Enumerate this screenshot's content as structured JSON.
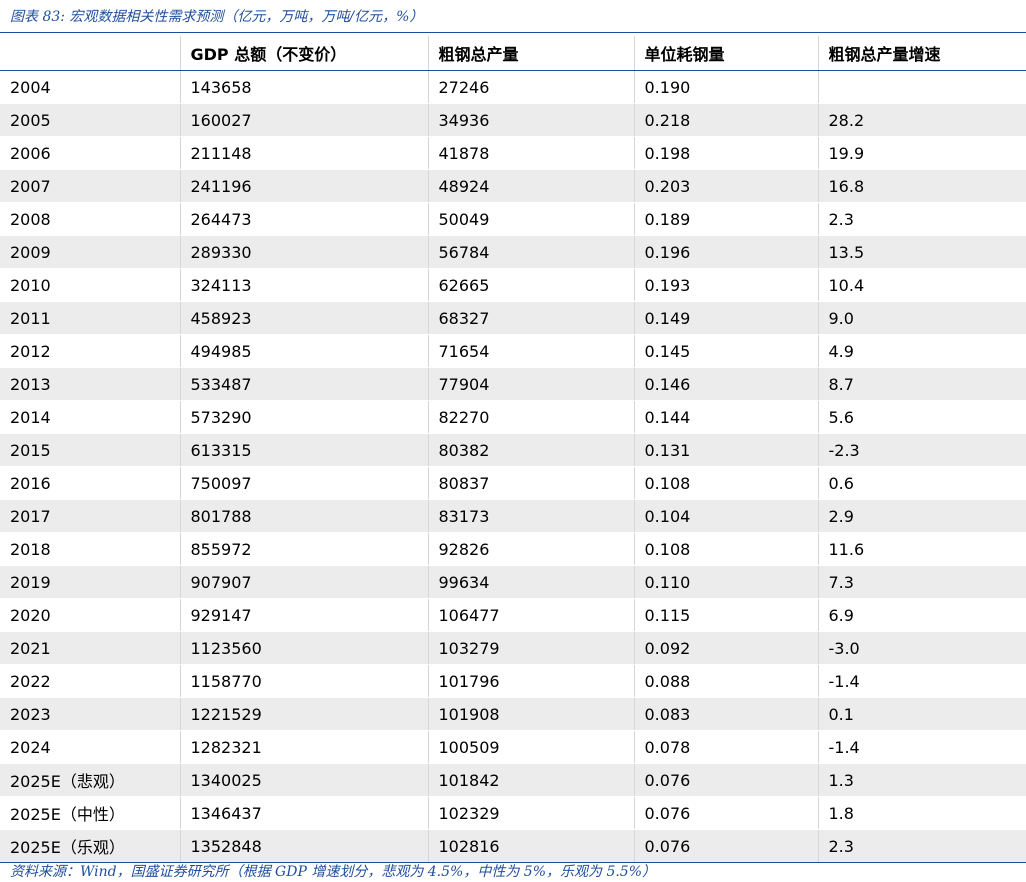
{
  "caption": "图表 83:  宏观数据相关性需求预测（亿元，万吨，万吨/亿元，%）",
  "source": "资料来源：Wind，国盛证券研究所（根据 GDP 增速划分，悲观为 4.5%，中性为 5%，乐观为 5.5%）",
  "colors": {
    "accent": "#1f4e9b",
    "row_shade": "#ececec"
  },
  "table": {
    "headers": [
      "",
      "GDP 总额（不变价）",
      "粗钢总产量",
      "单位耗钢量",
      "粗钢总产量增速"
    ],
    "rows": [
      [
        "2004",
        "143658",
        "27246",
        "0.190",
        ""
      ],
      [
        "2005",
        "160027",
        "34936",
        "0.218",
        "28.2"
      ],
      [
        "2006",
        "211148",
        "41878",
        "0.198",
        "19.9"
      ],
      [
        "2007",
        "241196",
        "48924",
        "0.203",
        "16.8"
      ],
      [
        "2008",
        "264473",
        "50049",
        "0.189",
        "2.3"
      ],
      [
        "2009",
        "289330",
        "56784",
        "0.196",
        "13.5"
      ],
      [
        "2010",
        "324113",
        "62665",
        "0.193",
        "10.4"
      ],
      [
        "2011",
        "458923",
        "68327",
        "0.149",
        "9.0"
      ],
      [
        "2012",
        "494985",
        "71654",
        "0.145",
        "4.9"
      ],
      [
        "2013",
        "533487",
        "77904",
        "0.146",
        "8.7"
      ],
      [
        "2014",
        "573290",
        "82270",
        "0.144",
        "5.6"
      ],
      [
        "2015",
        "613315",
        "80382",
        "0.131",
        "-2.3"
      ],
      [
        "2016",
        "750097",
        "80837",
        "0.108",
        "0.6"
      ],
      [
        "2017",
        "801788",
        "83173",
        "0.104",
        "2.9"
      ],
      [
        "2018",
        "855972",
        "92826",
        "0.108",
        "11.6"
      ],
      [
        "2019",
        "907907",
        "99634",
        "0.110",
        "7.3"
      ],
      [
        "2020",
        "929147",
        "106477",
        "0.115",
        "6.9"
      ],
      [
        "2021",
        "1123560",
        "103279",
        "0.092",
        "-3.0"
      ],
      [
        "2022",
        "1158770",
        "101796",
        "0.088",
        "-1.4"
      ],
      [
        "2023",
        "1221529",
        "101908",
        "0.083",
        "0.1"
      ],
      [
        "2024",
        "1282321",
        "100509",
        "0.078",
        "-1.4"
      ],
      [
        "2025E（悲观）",
        "1340025",
        "101842",
        "0.076",
        "1.3"
      ],
      [
        "2025E（中性）",
        "1346437",
        "102329",
        "0.076",
        "1.8"
      ],
      [
        "2025E（乐观）",
        "1352848",
        "102816",
        "0.076",
        "2.3"
      ]
    ]
  }
}
